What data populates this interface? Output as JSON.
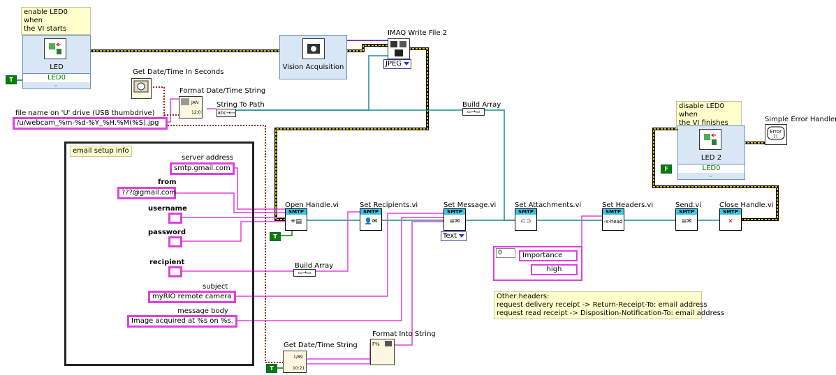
{
  "comments": {
    "enable_led": "enable LED0 when\nthe VI starts",
    "disable_led": "disable LED0 when\nthe VI finishes",
    "other_headers_title": "Other headers:",
    "other_headers_line1": "request delivery receipt -> Return-Receipt-To: email address",
    "other_headers_line2": "request read receipt -> Disposition-Notification-To: email address"
  },
  "nodes": {
    "led1_label": "LED",
    "led1_channel": "LED0",
    "led2_label": "LED 2",
    "led2_channel": "LED0",
    "vision_label": "Vision Acquisition",
    "imaq_label": "IMAQ Write File 2",
    "imaq_format": "JPEG",
    "get_datetime_seconds": "Get Date/Time In Seconds",
    "format_datetime": "Format Date/Time String",
    "string_to_path": "String To Path",
    "build_array_top": "Build Array",
    "build_array_bottom": "Build Array",
    "simple_error": "Simple Error Handler.vi",
    "open_handle": "Open Handle.vi",
    "set_recipients": "Set Recipients.vi",
    "set_message": "Set Message.vi",
    "set_message_type": "Text",
    "set_attachments": "Set Attachments.vi",
    "set_headers": "Set Headers.vi",
    "send": "Send.vi",
    "close_handle": "Close Handle.vi",
    "get_datetime_string": "Get Date/Time String",
    "format_into_string": "Format Into String",
    "smtp": "SMTP",
    "true_const": "T",
    "false_const": "F"
  },
  "file_name": {
    "label": "file name on 'U' drive (USB thumbdrive)",
    "value": "/u/webcam_%m-%d-%Y_%H.%M(%S).jpg"
  },
  "email_setup": {
    "title": "email setup info",
    "server_label": "server address",
    "server_value": "smtp.gmail.com",
    "from_label": "from",
    "from_value": "???@gmail.com",
    "username_label": "username",
    "password_label": "password",
    "recipient_label": "recipient",
    "subject_label": "subject",
    "subject_value": "myRIO remote camera",
    "body_label": "message body",
    "body_value": "Image acquired at %s on %s."
  },
  "headers": {
    "index": "0",
    "name": "Importance",
    "value": "high"
  },
  "colors": {
    "string_wire": "#e040e0",
    "cluster_wire": "#8b6b00",
    "path_wire": "#1c8c8c",
    "error_wire": "#d4c400",
    "dbl_wire": "#f08000",
    "bool_const": "#0a7d00"
  }
}
